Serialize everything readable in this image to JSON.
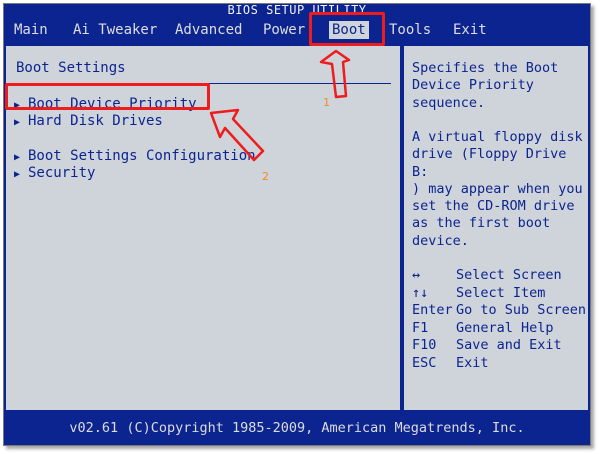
{
  "window": {
    "title": "BIOS SETUP UTILITY"
  },
  "menu": {
    "tabs": [
      {
        "label": "Main"
      },
      {
        "label": "Ai Tweaker"
      },
      {
        "label": "Advanced"
      },
      {
        "label": "Power"
      },
      {
        "label": "Boot",
        "active": true
      },
      {
        "label": "Tools"
      },
      {
        "label": "Exit"
      }
    ]
  },
  "left_panel": {
    "section_title": "Boot Settings",
    "items": [
      {
        "label": "Boot Device Priority"
      },
      {
        "label": "Hard Disk Drives"
      },
      {
        "label": "Boot Settings Configuration"
      },
      {
        "label": "Security"
      }
    ]
  },
  "help_panel": {
    "lines_1": [
      "Specifies the Boot",
      "Device Priority",
      "sequence."
    ],
    "lines_2": [
      "A virtual floppy disk",
      "drive (Floppy Drive B:",
      ") may appear when you",
      "set the CD-ROM drive",
      "as the first boot",
      "device."
    ],
    "keys": [
      {
        "key": "↔",
        "action": "Select Screen"
      },
      {
        "key": "↑↓",
        "action": "Select Item"
      },
      {
        "key": "Enter",
        "action": "Go to Sub Screen"
      },
      {
        "key": "F1",
        "action": "General Help"
      },
      {
        "key": "F10",
        "action": "Save and Exit"
      },
      {
        "key": "ESC",
        "action": "Exit"
      }
    ]
  },
  "footer": {
    "text": "v02.61 (C)Copyright 1985-2009, American Megatrends, Inc."
  },
  "annotations": {
    "step_1": "1",
    "step_2": "2"
  },
  "colors": {
    "bios_blue": "#0c2490",
    "panel_gray": "#cfd4da",
    "annotation_red": "#ee1c1c",
    "annotation_number": "#f08a2a"
  }
}
